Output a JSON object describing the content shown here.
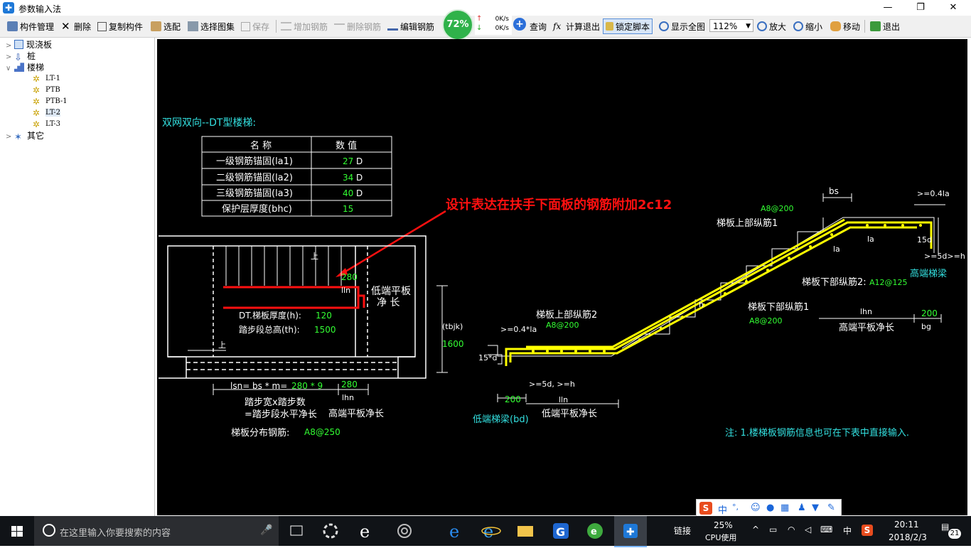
{
  "window": {
    "title": "参数输入法"
  },
  "toolbar": {
    "component_manage": "构件管理",
    "delete": "删除",
    "copy_component": "复制构件",
    "select": "选配",
    "choose_atlas": "选择图集",
    "save": "保存",
    "add_rebar": "增加钢筋",
    "delete_rebar": "删除钢筋",
    "edit_rebar": "编辑钢筋",
    "query": "查询",
    "calc_exit": "计算退出",
    "lock_script": "锁定脚本",
    "show_all": "显示全图",
    "zoom_level": "112%",
    "zoom_in": "放大",
    "zoom_out": "缩小",
    "move": "移动",
    "exit": "退出"
  },
  "net_monitor": {
    "percent": "72%",
    "up_rate": "0K/s",
    "down_rate": "0K/s"
  },
  "tree": {
    "items": [
      {
        "label": "现浇板"
      },
      {
        "label": "桩"
      },
      {
        "label": "楼梯"
      },
      {
        "label": "其它"
      }
    ],
    "stair_children": [
      {
        "label": "LT-1"
      },
      {
        "label": "PTB"
      },
      {
        "label": "PTB-1"
      },
      {
        "label": "LT-2"
      },
      {
        "label": "LT-3"
      }
    ]
  },
  "drawing": {
    "heading": "双网双向--DT型楼梯:",
    "table": {
      "headers": [
        "名 称",
        "数 值"
      ],
      "rows": [
        {
          "name": "一级钢筋锚固(la1)",
          "value": "27",
          "unit": "D"
        },
        {
          "name": "二级钢筋锚固(la2)",
          "value": "34",
          "unit": "D"
        },
        {
          "name": "三级钢筋锚固(la3)",
          "value": "40",
          "unit": "D"
        },
        {
          "name": "保护层厚度(bhc)",
          "value": "15",
          "unit": ""
        }
      ]
    },
    "annotation": "设计表达在扶手下面板的钢筋附加2c12",
    "plan": {
      "low_flat_1": "低端平板",
      "low_flat_2": "净 长",
      "val_280": "280",
      "lln": "lln",
      "thk_label": "DT.梯板厚度(h):",
      "thk_val": "120",
      "th_label": "踏步段总高(th):",
      "th_val": "1500",
      "lsn_label": "lsn= bs * m=",
      "lsn_val": "280 * 9",
      "val_280b": "280",
      "lhn": "lhn",
      "tread_1": "踏步宽x踏步数",
      "tread_2": "=踏步段水平净长",
      "high_flat_len": "高端平板净长",
      "dist_label": "梯板分布钢筋:",
      "dist_val": "A8@250",
      "mark_up": "上",
      "mark_up2": "上"
    },
    "section": {
      "tbjk": "(tbjk)",
      "h1600": "1600",
      "d15": "15*d",
      "v200_low": "200",
      "lln": "lln",
      "low_beam": "低端梯梁(bd)",
      "low_flat_len": "低端平板净长",
      "ge5d": ">=5d, >=h",
      "ge04la_l": ">=0.4*la",
      "a8_200_l": "A8@200",
      "upper_long2": "梯板上部纵筋2",
      "h_mark": "h",
      "lower_long1": "梯板下部纵筋1",
      "a8_200_m": "A8@200",
      "bs": "bs",
      "a8_200_t": "A8@200",
      "upper_long1": "梯板上部纵筋1",
      "la_1": "la",
      "la_2": "la",
      "ge04la_r": ">=0.4la",
      "d15_r": "15d",
      "ge5d_r": ">=5d>=h",
      "high_beam": "高端梯梁",
      "lower_long2": "梯板下部纵筋2:",
      "a12_125": "A12@125",
      "lhn": "lhn",
      "v200_high": "200",
      "high_flat_len": "高端平板净长",
      "bg": "bg"
    },
    "note": "注: 1.楼梯板钢筋信息也可在下表中直接输入."
  },
  "taskbar": {
    "search_placeholder": "在这里输入你要搜索的内容",
    "link_label": "链接",
    "cpu_percent": "25%",
    "cpu_label": "CPU使用",
    "ime": "中",
    "time": "20:11",
    "date": "2018/2/3",
    "notif_count": "21"
  },
  "ime_bar": {
    "mode": "中",
    "punct": "°,"
  },
  "colors": {
    "canvas_bg": "#000000",
    "line": "#ffffff",
    "value_green": "#33ff33",
    "label_cyan": "#33e0e0",
    "rebar_yellow": "#ffff00",
    "annotation_red": "#ff1010"
  }
}
